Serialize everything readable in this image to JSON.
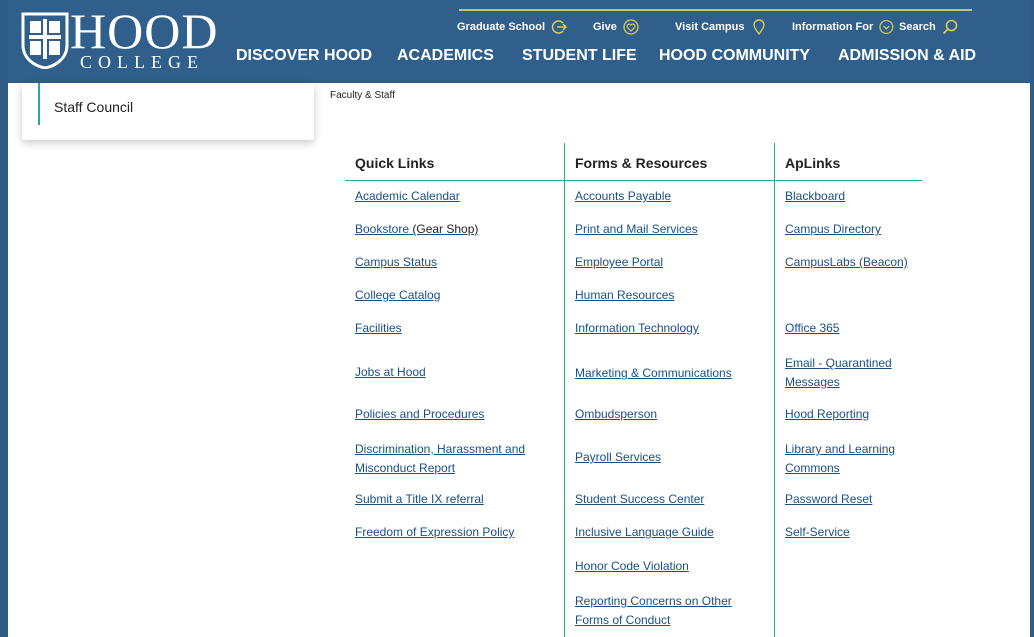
{
  "header": {
    "logo_main": "HOOD",
    "logo_sub": "COLLEGE",
    "utility_nav": [
      {
        "label": "Graduate School",
        "icon": "arrow-right-circle-icon"
      },
      {
        "label": "Give",
        "icon": "heart-circle-icon"
      },
      {
        "label": "Visit Campus",
        "icon": "map-pin-icon"
      },
      {
        "label": "Information For",
        "icon": "chevron-down-circle-icon"
      },
      {
        "label": "Search",
        "icon": "search-icon"
      }
    ],
    "main_nav": [
      "DISCOVER HOOD",
      "ACADEMICS",
      "STUDENT LIFE",
      "HOOD COMMUNITY",
      "ADMISSION & AID"
    ]
  },
  "sidebar": {
    "active_item": "Staff Council"
  },
  "breadcrumb": "Faculty & Staff",
  "columns": [
    {
      "heading": "Quick Links",
      "links": [
        {
          "text": "Academic Calendar"
        },
        {
          "text": "Bookstore",
          "suffix": " (Gear Shop)"
        },
        {
          "text": "Campus Status"
        },
        {
          "text": "College Catalog"
        },
        {
          "text": "Facilities"
        },
        {
          "text": "Jobs at Hood"
        },
        {
          "text": "Policies and Procedures"
        },
        {
          "text": "Discrimination, Harassment and Misconduct Report"
        },
        {
          "text": "Submit a Title IX referral"
        },
        {
          "text": "Freedom of Expression Policy"
        }
      ]
    },
    {
      "heading": "Forms & Resources",
      "links": [
        {
          "text": "Accounts Payable"
        },
        {
          "text": "Print and Mail Services"
        },
        {
          "text": "Employee Portal"
        },
        {
          "text": "Human Resources"
        },
        {
          "text": "Information Technology"
        },
        {
          "text": "Marketing & Communications"
        },
        {
          "text": "Ombudsperson"
        },
        {
          "text": "Payroll Services"
        },
        {
          "text": "Student Success Center"
        },
        {
          "text": "Inclusive Language Guide"
        },
        {
          "text": "Honor Code Violation"
        },
        {
          "text": "Reporting Concerns on Other Forms of Conduct"
        }
      ]
    },
    {
      "heading": "ApLinks",
      "links": [
        {
          "text": "Blackboard"
        },
        {
          "text": "Campus Directory"
        },
        {
          "text": "CampusLabs (Beacon)"
        },
        {
          "text": "Office 365"
        },
        {
          "text": "Email - Quarantined Messages"
        },
        {
          "text": "Hood Reporting"
        },
        {
          "text": "Library and Learning Commons"
        },
        {
          "text": "Password Reset"
        },
        {
          "text": "Self-Service"
        }
      ]
    }
  ],
  "colors": {
    "header_bg": "#2f5f8a",
    "accent_teal": "#2aa8a0",
    "link": "#1a4f86",
    "gold": "#d8cc5a"
  }
}
